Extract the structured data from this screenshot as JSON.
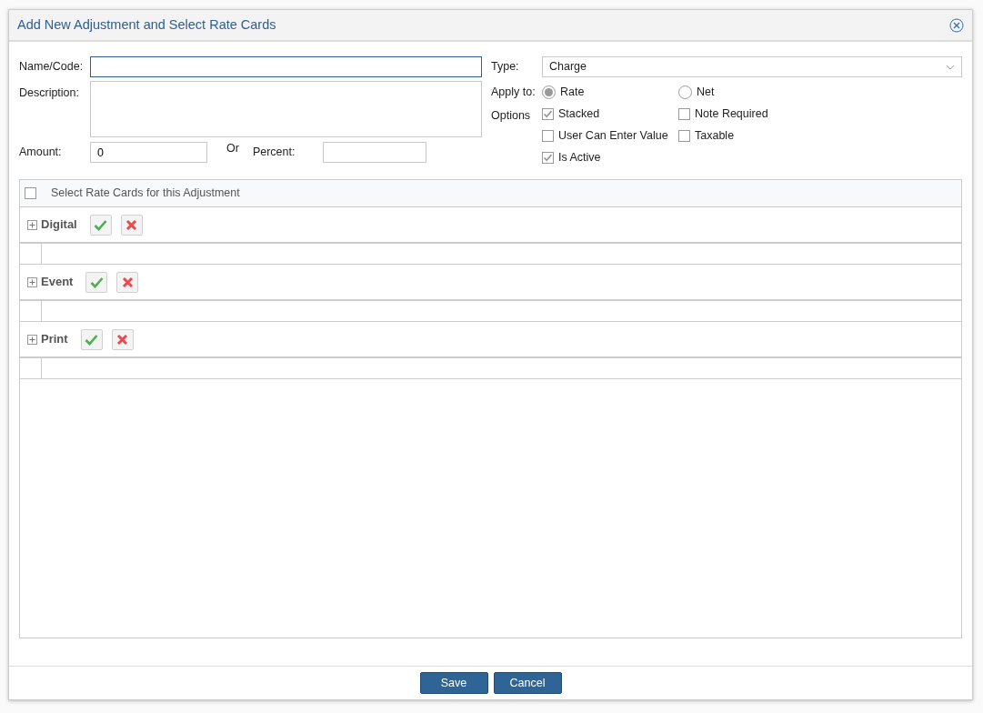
{
  "dialog": {
    "title": "Add New Adjustment and Select Rate Cards"
  },
  "form": {
    "name_code": {
      "label": "Name/Code:",
      "focused": true
    },
    "description": {
      "label": "Description:"
    },
    "amount": {
      "label": "Amount:",
      "value": "0"
    },
    "or_text": "Or",
    "percent": {
      "label": "Percent:"
    },
    "type": {
      "label": "Type:",
      "value": "Charge"
    },
    "apply_to": {
      "label": "Apply to:",
      "options": [
        {
          "label": "Rate",
          "selected": true
        },
        {
          "label": "Net",
          "selected": false
        }
      ]
    },
    "options": {
      "label": "Options",
      "items": [
        {
          "label": "Stacked",
          "checked": true
        },
        {
          "label": "Note Required",
          "checked": false
        },
        {
          "label": "User Can Enter Value",
          "checked": false
        },
        {
          "label": "Taxable",
          "checked": false
        },
        {
          "label": "Is Active",
          "checked": true
        }
      ]
    }
  },
  "rate_cards": {
    "header": {
      "label": "Select Rate Cards for this Adjustment",
      "checked": false
    },
    "groups": [
      {
        "name": "Digital",
        "expanded": false
      },
      {
        "name": "Event",
        "expanded": false
      },
      {
        "name": "Print",
        "expanded": false
      }
    ]
  },
  "buttons": [
    "Save",
    "Cancel"
  ]
}
